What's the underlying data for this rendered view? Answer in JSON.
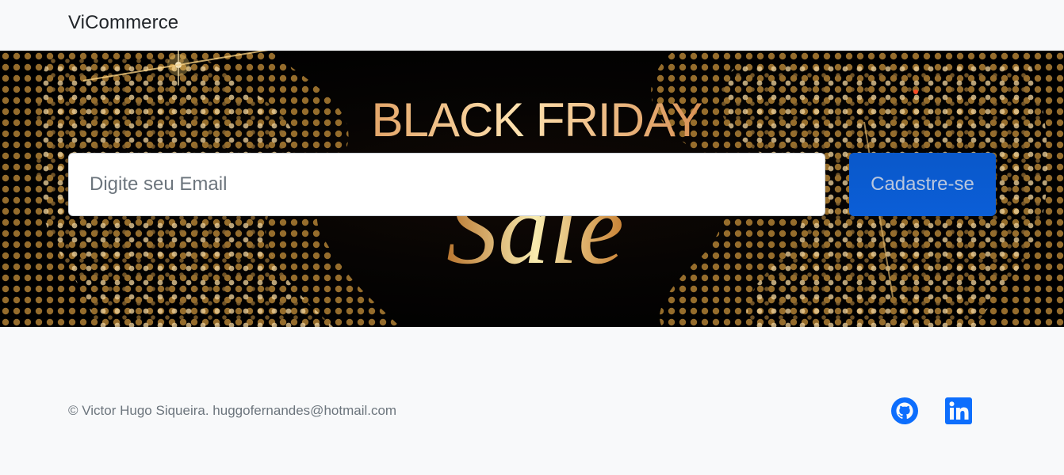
{
  "navbar": {
    "brand": "ViCommerce"
  },
  "hero": {
    "banner_line1": "BLACK FRIDAY",
    "banner_line2": "Sale",
    "email_placeholder": "Digite seu Email",
    "signup_label": "Cadastre-se"
  },
  "footer": {
    "copyright": "© Victor Hugo Siqueira. huggofernandes@hotmail.com",
    "social": [
      {
        "icon": "github-icon"
      },
      {
        "icon": "linkedin-icon"
      }
    ]
  },
  "colors": {
    "page_bg": "#f8f9fa",
    "brand_text": "#212529",
    "primary": "#0b5ed7",
    "muted_text": "#6c757d",
    "gold": "#d7a84b",
    "banner_bg": "#000000"
  }
}
